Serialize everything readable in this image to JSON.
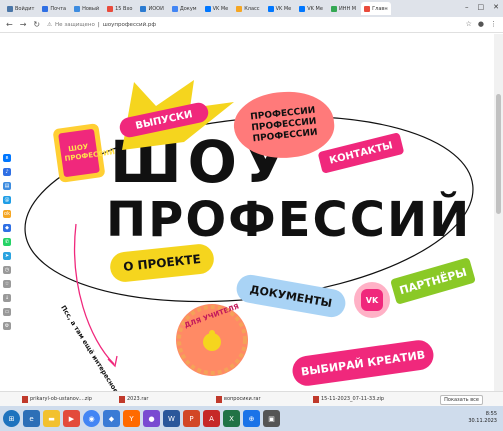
{
  "browser": {
    "tabs": [
      {
        "label": "Войдит",
        "color": "#4a76a8"
      },
      {
        "label": "Почта",
        "color": "#2f6fe4"
      },
      {
        "label": "Новый",
        "color": "#3d8ce0"
      },
      {
        "label": "15 Вхо",
        "color": "#e94b3c"
      },
      {
        "label": "ИООИ",
        "color": "#2b7bd1"
      },
      {
        "label": "Докум",
        "color": "#4285f4"
      },
      {
        "label": "VK Ме",
        "color": "#0077ff"
      },
      {
        "label": "Класс",
        "color": "#f5a623"
      },
      {
        "label": "VK Ме",
        "color": "#0077ff"
      },
      {
        "label": "VK Ме",
        "color": "#0077ff"
      },
      {
        "label": "ИНН М",
        "color": "#34a853"
      },
      {
        "label": "Главн",
        "color": "#e94b3c"
      }
    ],
    "active_tab_index": 11,
    "url_warning": "Не защищено",
    "url": "шоупрофессий.рф"
  },
  "site": {
    "title_line1": "ШОУ",
    "title_line2": "ПРОФЕССИЙ",
    "logo_text": "ШОУ ПРОФЕССИЙ",
    "sticker_vypuski": "ВЫПУСКИ",
    "sticker_professii": [
      "ПРОФЕССИИ",
      "ПРОФЕССИИ",
      "ПРОФЕССИИ"
    ],
    "sticker_kontakty": "КОНТАКТЫ",
    "sticker_o_proekte": "О ПРОЕКТЕ",
    "sticker_partnery": "ПАРТНЁРЫ",
    "sticker_dokumenty": "ДОКУМЕНТЫ",
    "sticker_vk": "VK",
    "sticker_dlya_uchitelya": "ДЛЯ УЧИТЕЛЯ",
    "sticker_vybiray": "ВЫБИРАЙ КРЕАТИВ",
    "scroll_hint": "Псс, а там ещё интересное :)"
  },
  "downloads": {
    "items": [
      "prikaryl-ob-ustanov....zip",
      "2023.rar",
      "вопросики.rar",
      "15-11-2023_07-11-33.zip"
    ],
    "show_all": "Показать все"
  },
  "taskbar": {
    "time": "8:55",
    "date": "30.11.2023"
  },
  "colors": {
    "pink": "#f0287c",
    "yellow": "#f5d51e",
    "coral": "#ff6b6b",
    "green": "#8ac926",
    "blue_light": "#a9d3f5",
    "lilac": "#ffb1c6"
  }
}
